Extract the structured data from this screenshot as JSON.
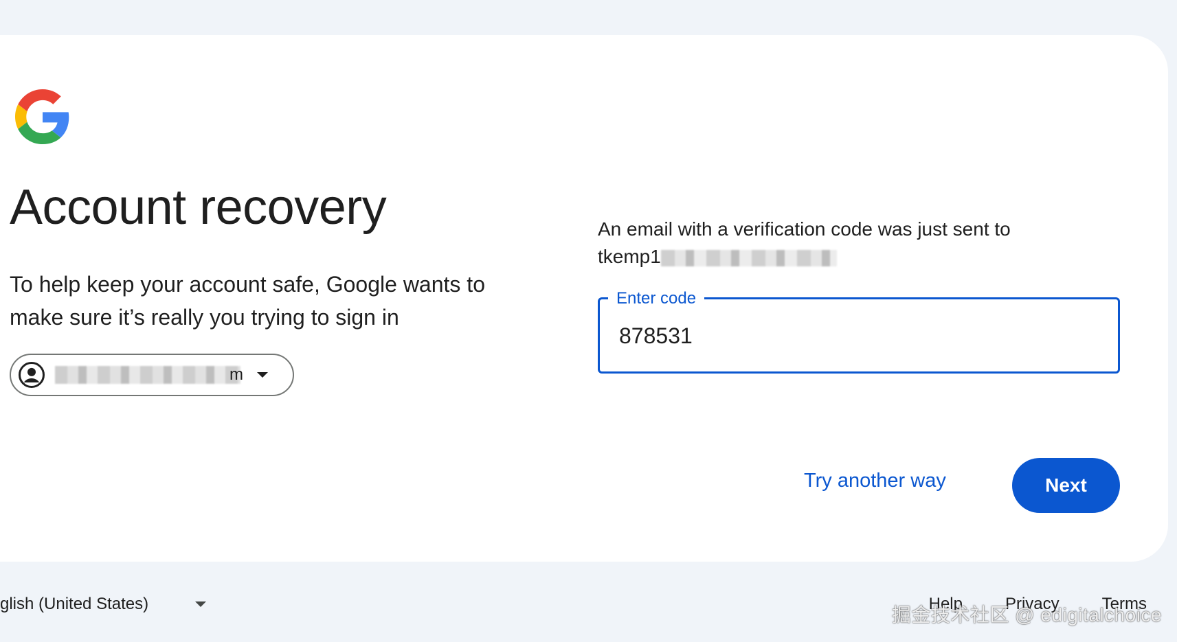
{
  "header": {
    "logo_icon": "google-g-logo-icon"
  },
  "main": {
    "title": "Account recovery",
    "subtitle": "To help keep your account safe, Google wants to make sure it’s really you trying to sign in",
    "account_chip": {
      "avatar_icon": "account-circle-icon",
      "email_visible_suffix": "m",
      "dropdown_icon": "caret-down-icon"
    },
    "sent_message": "An email with a verification code was just sent to",
    "sent_address_visible": "tkemp1",
    "code_field": {
      "label": "Enter code",
      "value": "878531"
    },
    "actions": {
      "try_another": "Try another way",
      "next": "Next"
    }
  },
  "footer": {
    "language": "glish (United States)",
    "links": [
      "Help",
      "Privacy",
      "Terms"
    ]
  },
  "watermark": "掘金技术社区 @ edigitalchoice",
  "colors": {
    "accent": "#0b57d0",
    "page_background": "#f0f4f9",
    "card_background": "#ffffff",
    "text": "#1f1f1f"
  }
}
